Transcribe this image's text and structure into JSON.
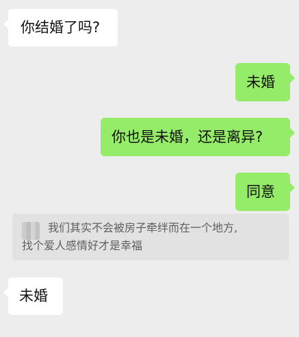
{
  "messages": [
    {
      "side": "left",
      "text": "你结婚了吗?"
    },
    {
      "side": "right",
      "text": "未婚"
    },
    {
      "side": "right",
      "text": "你也是未婚，还是离异?"
    },
    {
      "side": "right",
      "text": "同意"
    },
    {
      "side": "left",
      "text": "未婚"
    }
  ],
  "quote": {
    "line1": "我们其实不会被房子牵绊而在一个地方,",
    "line2": "找个爱人感情好才是幸福"
  },
  "colors": {
    "background": "#ededed",
    "sent_bubble": "#95ec69",
    "received_bubble": "#ffffff",
    "quote_background": "#e2e2e2"
  }
}
